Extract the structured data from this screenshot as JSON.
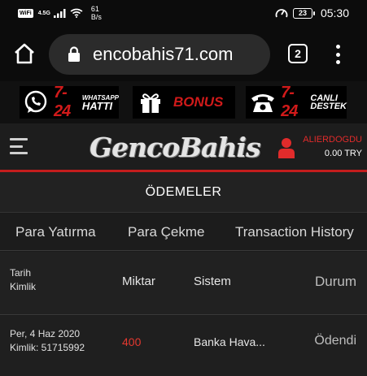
{
  "status_bar": {
    "wifi_badge": "WiFi",
    "signal_label": "4.5G",
    "speed_value": "61",
    "speed_unit": "B/s",
    "battery": "23",
    "time": "05:30"
  },
  "browser": {
    "url": "encobahis71.com",
    "tab_count": "2"
  },
  "promos": [
    {
      "number": "7-24",
      "label_top": "WHATSAPP",
      "label_bottom": "HATTI"
    },
    {
      "label": "BONUS"
    },
    {
      "number": "7-24",
      "label_top": "CANLI",
      "label_bottom": "DESTEK"
    }
  ],
  "header": {
    "logo_text": "GencoBahis",
    "username": "ALIERDOGDU",
    "balance": "0.00 TRY"
  },
  "page": {
    "title": "ÖDEMELER"
  },
  "tabs": [
    {
      "label": "Para Yatırma"
    },
    {
      "label": "Para Çekme"
    },
    {
      "label": "Transaction History"
    }
  ],
  "table": {
    "headers": {
      "date": "Tarih",
      "id": "Kimlik",
      "amount": "Miktar",
      "system": "Sistem",
      "status": "Durum"
    },
    "rows": [
      {
        "date": "Per, 4 Haz 2020",
        "id": "Kimlik: 51715992",
        "amount": "400",
        "system": "Banka Hava...",
        "status": "Ödendi"
      }
    ]
  },
  "colors": {
    "accent_red": "#d11a1a",
    "background": "#1b1b1b"
  }
}
